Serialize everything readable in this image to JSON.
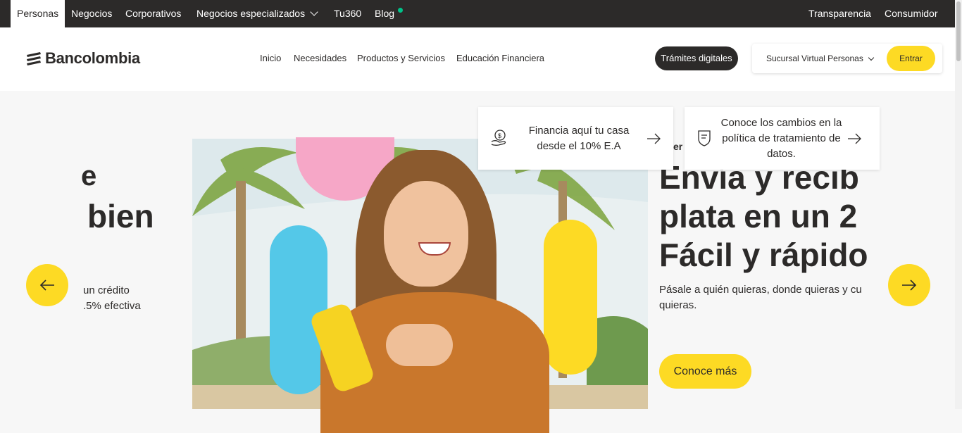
{
  "topnav": {
    "left": [
      "Personas",
      "Negocios",
      "Corporativos",
      "Negocios especializados",
      "Tu360",
      "Blog"
    ],
    "right": [
      "Transparencia",
      "Consumidor"
    ],
    "active": "Personas"
  },
  "header": {
    "logo_text": "Bancolombia",
    "nav": [
      "Inicio",
      "Necesidades",
      "Productos y Servicios",
      "Educación Financiera"
    ],
    "tramites_label": "Trámites digitales",
    "sucursal_label": "Sucursal Virtual Personas",
    "entrar_label": "Entrar"
  },
  "cards": [
    {
      "icon": "house-money-icon",
      "text": "Financia aquí tu casa desde el 10% E.A"
    },
    {
      "icon": "document-shield-icon",
      "text": "Conoce los cambios en la política de tratamiento de datos."
    }
  ],
  "slides": {
    "left": {
      "title_fragment": "e",
      "title_line": "bien",
      "desc_line1": "un crédito",
      "desc_line2": ".5% efectiva"
    },
    "right": {
      "eyebrow": "er",
      "title_lines": [
        "Envía y recib",
        "plata en un 2",
        "Fácil y rápido"
      ],
      "description": "Pásale a quién quieras, donde quieras y cu quieras.",
      "cta": "Conoce más"
    }
  },
  "colors": {
    "brand_yellow": "#fdda24",
    "dark": "#2c2a29",
    "blog_dot": "#00c389"
  }
}
